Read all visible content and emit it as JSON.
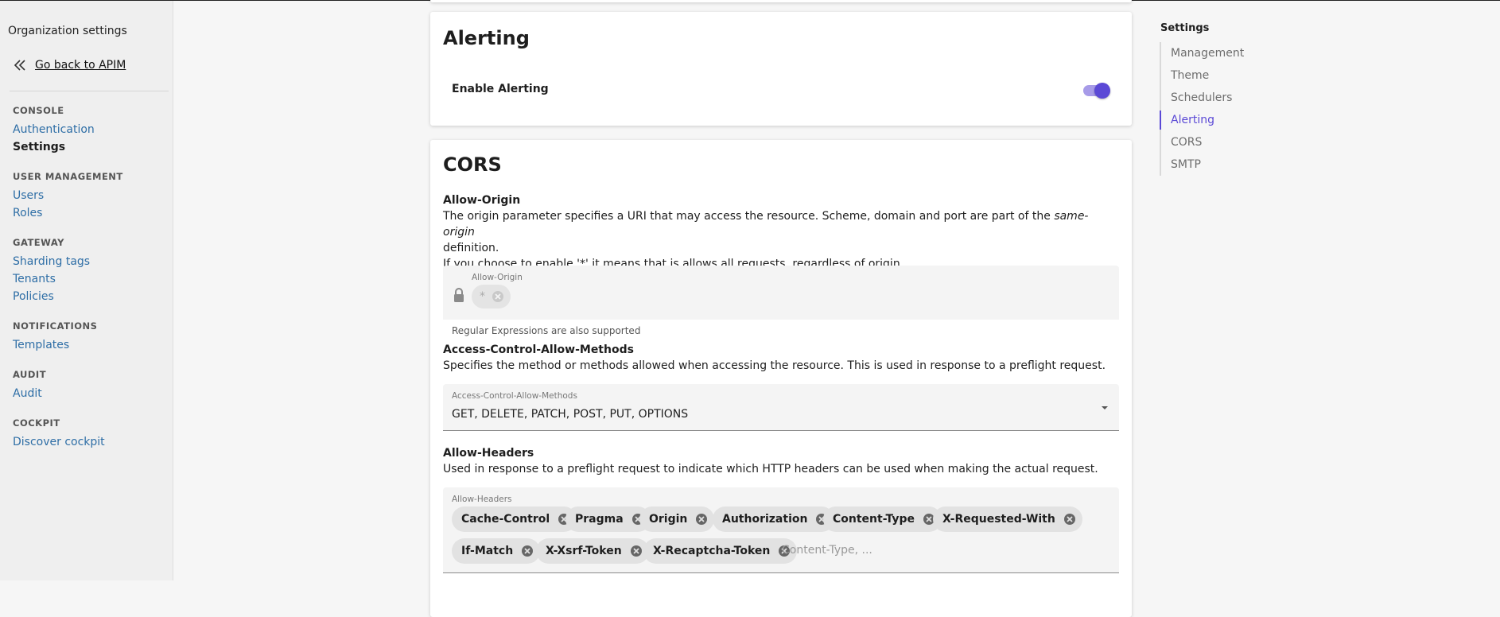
{
  "sidebar": {
    "org_title": "Organization settings",
    "back_label": "Go back to APIM",
    "sections": [
      {
        "title": "CONSOLE",
        "items": [
          "Authentication",
          "Settings"
        ]
      },
      {
        "title": "USER MANAGEMENT",
        "items": [
          "Users",
          "Roles"
        ]
      },
      {
        "title": "GATEWAY",
        "items": [
          "Sharding tags",
          "Tenants",
          "Policies"
        ]
      },
      {
        "title": "NOTIFICATIONS",
        "items": [
          "Templates"
        ]
      },
      {
        "title": "AUDIT",
        "items": [
          "Audit"
        ]
      },
      {
        "title": "COCKPIT",
        "items": [
          "Discover cockpit"
        ]
      }
    ],
    "active_item": "Settings"
  },
  "alerting": {
    "title": "Alerting",
    "enable_label": "Enable Alerting",
    "enabled": true
  },
  "cors": {
    "title": "CORS",
    "allow_origin": {
      "heading": "Allow-Origin",
      "desc_part1": "The origin parameter specifies a URI that may access the resource. Scheme, domain and port are part of the ",
      "desc_em": "same-origin",
      "desc_part2": "definition.",
      "desc_line2": "If you choose to enable '*' it means that is allows all requests, regardless of origin.",
      "field_label": "Allow-Origin",
      "value": "*",
      "hint": "Regular Expressions are also supported"
    },
    "methods": {
      "heading": "Access-Control-Allow-Methods",
      "desc": "Specifies the method or methods allowed when accessing the resource. This is used in response to a preflight request.",
      "field_label": "Access-Control-Allow-Methods",
      "value": "GET, DELETE, PATCH, POST, PUT, OPTIONS"
    },
    "headers": {
      "heading": "Allow-Headers",
      "desc": "Used in response to a preflight request to indicate which HTTP headers can be used when making the actual request.",
      "field_label": "Allow-Headers",
      "chips": [
        "Cache-Control",
        "Pragma",
        "Origin",
        "Authorization",
        "Content-Type",
        "X-Requested-With",
        "If-Match",
        "X-Xsrf-Token",
        "X-Recaptcha-Token"
      ],
      "placeholder": "Content-Type, ..."
    }
  },
  "toc": {
    "title": "Settings",
    "items": [
      "Management",
      "Theme",
      "Schedulers",
      "Alerting",
      "CORS",
      "SMTP"
    ],
    "active": "Alerting"
  },
  "colors": {
    "accent": "#5b49d6",
    "link": "#2e6ea6"
  }
}
